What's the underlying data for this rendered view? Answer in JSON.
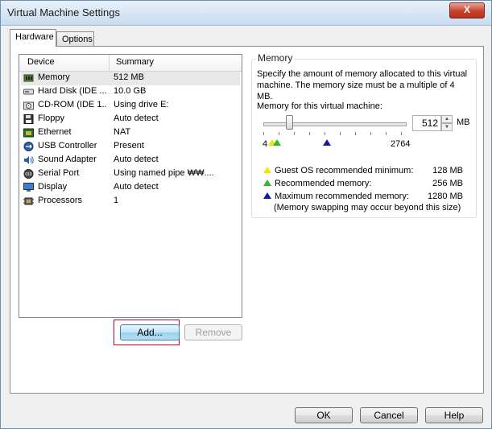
{
  "window": {
    "title": "Virtual Machine Settings",
    "close_label": "X"
  },
  "tabs": [
    {
      "label": "Hardware"
    },
    {
      "label": "Options"
    }
  ],
  "device_list": {
    "columns": {
      "device": "Device",
      "summary": "Summary"
    },
    "rows": [
      {
        "device": "Memory",
        "summary": "512 MB",
        "icon": "memory-icon"
      },
      {
        "device": "Hard Disk (IDE ...",
        "summary": "10.0 GB",
        "icon": "hard-disk-icon"
      },
      {
        "device": "CD-ROM (IDE 1...",
        "summary": "Using drive E:",
        "icon": "cdrom-icon"
      },
      {
        "device": "Floppy",
        "summary": "Auto detect",
        "icon": "floppy-icon"
      },
      {
        "device": "Ethernet",
        "summary": "NAT",
        "icon": "ethernet-icon"
      },
      {
        "device": "USB Controller",
        "summary": "Present",
        "icon": "usb-icon"
      },
      {
        "device": "Sound Adapter",
        "summary": "Auto detect",
        "icon": "sound-icon"
      },
      {
        "device": "Serial Port",
        "summary": "Using named pipe ₩₩....",
        "icon": "serial-port-icon"
      },
      {
        "device": "Display",
        "summary": "Auto detect",
        "icon": "display-icon"
      },
      {
        "device": "Processors",
        "summary": "1",
        "icon": "processor-icon"
      }
    ],
    "selected_index": 0
  },
  "buttons": {
    "add": "Add...",
    "remove": "Remove",
    "ok": "OK",
    "cancel": "Cancel",
    "help": "Help"
  },
  "memory": {
    "group_title": "Memory",
    "description": "Specify the amount of memory allocated to this virtual machine. The memory size must be a multiple of 4 MB.",
    "field_label": "Memory for this virtual machine:",
    "value": "512",
    "unit": "MB",
    "range_min": "4",
    "range_max": "2764",
    "legend": [
      {
        "label": "Guest OS recommended minimum:",
        "value": "128 MB",
        "color": "#f2e600"
      },
      {
        "label": "Recommended memory:",
        "value": "256 MB",
        "color": "#2eb82e"
      },
      {
        "label": "Maximum recommended memory:",
        "value": "1280 MB",
        "color": "#1a1aa0"
      }
    ],
    "note": "(Memory swapping may occur beyond this size)"
  }
}
